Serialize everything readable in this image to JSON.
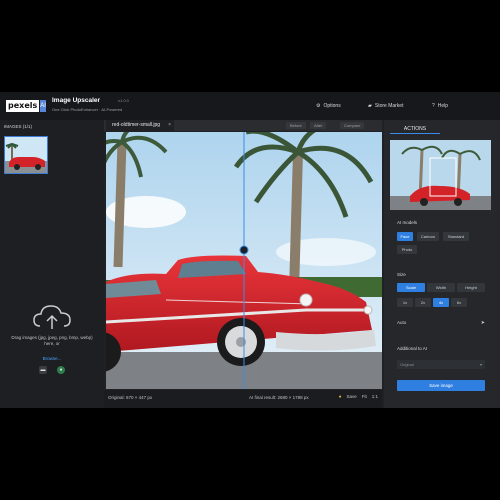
{
  "app": {
    "logo_word": "pexels",
    "logo_badge": "AI",
    "title": "Image Upscaler",
    "version": "v1.0.0",
    "subtitle": "One Click PhotoEnhancer · AI-Powered"
  },
  "menu": {
    "options": "Options",
    "store": "Store Market",
    "help": "Help"
  },
  "sidebar": {
    "images_label": "IMAGES (1/1)",
    "drop_text": "Drag images (jpg, jpeg, png, bmp, webp) here, or",
    "browse": "Browse..."
  },
  "tabs": {
    "file": "red-oldtimer-small.jpg",
    "close": "×",
    "tool_1": "Before",
    "tool_2": "After",
    "tool_3": "Compare"
  },
  "status": {
    "original": "Original: 670 × 447 px",
    "ai_result": "AI final result: 2680 × 1788 px",
    "tool_save": "Save",
    "tool_fit": "Fit",
    "tool_zoom": "1:1"
  },
  "panel": {
    "tab": "ACTIONS",
    "models_label": "AI models",
    "models": [
      "Face",
      "Cartoon",
      "Standard",
      "Photo"
    ],
    "active_model": "Face",
    "size_label": "Size",
    "size_modes": [
      "Scale",
      "Width",
      "Height"
    ],
    "active_size_mode": "Scale",
    "scales": [
      "1x",
      "2x",
      "4x",
      "6x"
    ],
    "active_scale": "4x",
    "auto_label": "Auto",
    "adjust_label": "Additional to AI",
    "select_placeholder": "Original",
    "save_button": "Save image"
  },
  "colors": {
    "accent": "#2f7fe0",
    "car": "#d32228",
    "sky": "#cfe6f4"
  }
}
